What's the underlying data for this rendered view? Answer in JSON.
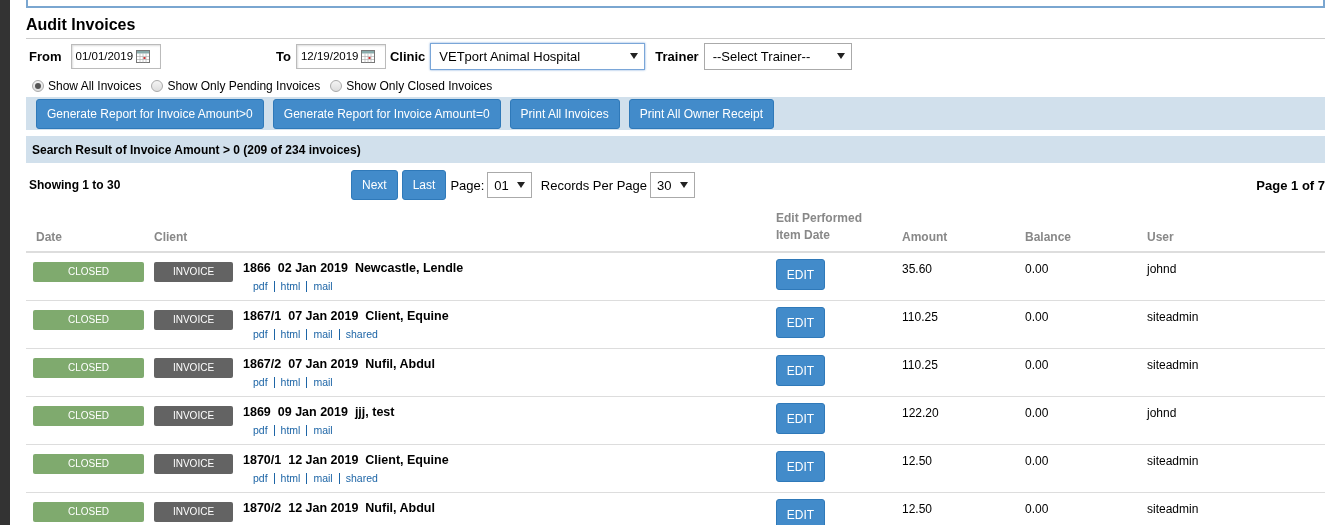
{
  "title": "Audit Invoices",
  "filters": [
    {
      "kind": "date",
      "label": "From",
      "value": "01/01/2019"
    },
    {
      "kind": "date",
      "label": "To",
      "value": "12/19/2019"
    },
    {
      "kind": "select",
      "label": "Clinic",
      "value": "VETport Animal Hospital",
      "focused": true
    },
    {
      "kind": "select",
      "label": "Trainer",
      "value": "--Select Trainer--",
      "focused": false
    }
  ],
  "radios": [
    {
      "label": "Show All Invoices",
      "selected": true
    },
    {
      "label": "Show Only Pending Invoices",
      "selected": false
    },
    {
      "label": "Show Only Closed Invoices",
      "selected": false
    }
  ],
  "actions": [
    "Generate Report for Invoice Amount>0",
    "Generate Report for Invoice Amount=0",
    "Print All Invoices",
    "Print All Owner Receipt"
  ],
  "result_title": "Search Result of Invoice Amount > 0 (209 of 234 invoices)",
  "pager": {
    "showing": "Showing 1 to 30",
    "next": "Next",
    "last": "Last",
    "page_label": "Page:",
    "page": "01",
    "per_page_label": "Records Per Page",
    "per_page": "30",
    "page_info": "Page 1 of 7"
  },
  "table": {
    "columns": [
      "Date",
      "Client",
      "Edit Performed Item Date",
      "Amount",
      "Balance",
      "User"
    ],
    "rows": [
      {
        "status": "CLOSED",
        "type": "INVOICE",
        "number": "1866",
        "date": "02 Jan 2019",
        "client": "Newcastle, Lendle",
        "links": [
          "pdf",
          "html",
          "mail"
        ],
        "edit": "EDIT",
        "amount": "35.60",
        "balance": "0.00",
        "user": "johnd"
      },
      {
        "status": "CLOSED",
        "type": "INVOICE",
        "number": "1867/1",
        "date": "07 Jan 2019",
        "client": "Client, Equine",
        "links": [
          "pdf",
          "html",
          "mail",
          "shared"
        ],
        "edit": "EDIT",
        "amount": "110.25",
        "balance": "0.00",
        "user": "siteadmin"
      },
      {
        "status": "CLOSED",
        "type": "INVOICE",
        "number": "1867/2",
        "date": "07 Jan 2019",
        "client": "Nufil, Abdul",
        "links": [
          "pdf",
          "html",
          "mail"
        ],
        "edit": "EDIT",
        "amount": "110.25",
        "balance": "0.00",
        "user": "siteadmin"
      },
      {
        "status": "CLOSED",
        "type": "INVOICE",
        "number": "1869",
        "date": "09 Jan 2019",
        "client": "jjj, test",
        "links": [
          "pdf",
          "html",
          "mail"
        ],
        "edit": "EDIT",
        "amount": "122.20",
        "balance": "0.00",
        "user": "johnd"
      },
      {
        "status": "CLOSED",
        "type": "INVOICE",
        "number": "1870/1",
        "date": "12 Jan 2019",
        "client": "Client, Equine",
        "links": [
          "pdf",
          "html",
          "mail",
          "shared"
        ],
        "edit": "EDIT",
        "amount": "12.50",
        "balance": "0.00",
        "user": "siteadmin"
      },
      {
        "status": "CLOSED",
        "type": "INVOICE",
        "number": "1870/2",
        "date": "12 Jan 2019",
        "client": "Nufil, Abdul",
        "edit": "EDIT",
        "amount": "12.50",
        "balance": "0.00",
        "user": "siteadmin"
      }
    ]
  }
}
